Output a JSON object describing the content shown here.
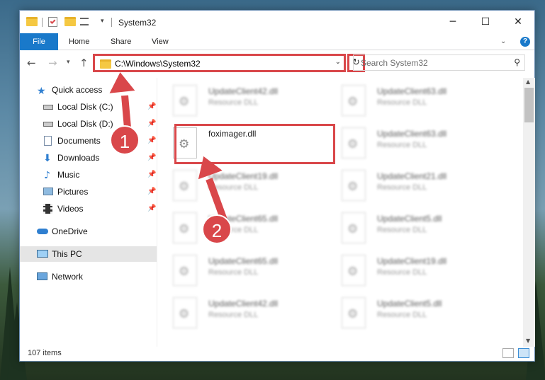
{
  "titlebar": {
    "title": "System32",
    "minimize_symbol": "─",
    "maximize_symbol": "☐",
    "close_symbol": "✕"
  },
  "ribbon": {
    "tabs": [
      "File",
      "Home",
      "Share",
      "View"
    ],
    "help_symbol": "?"
  },
  "navigation": {
    "address": "C:\\Windows\\System32",
    "search_placeholder": "Search System32"
  },
  "sidebar": {
    "items": [
      {
        "label": "Quick access",
        "icon": "star-icon",
        "pinned": false
      },
      {
        "label": "Local Disk (C:)",
        "icon": "drive-icon",
        "pinned": true
      },
      {
        "label": "Local Disk (D:)",
        "icon": "drive-icon",
        "pinned": true
      },
      {
        "label": "Documents",
        "icon": "documents-icon",
        "pinned": true
      },
      {
        "label": "Downloads",
        "icon": "download-icon",
        "pinned": true
      },
      {
        "label": "Music",
        "icon": "music-icon",
        "pinned": true
      },
      {
        "label": "Pictures",
        "icon": "pictures-icon",
        "pinned": true
      },
      {
        "label": "Videos",
        "icon": "videos-icon",
        "pinned": true
      },
      {
        "label": "OneDrive",
        "icon": "cloud-icon",
        "pinned": false
      },
      {
        "label": "This PC",
        "icon": "computer-icon",
        "pinned": false,
        "selected": true
      },
      {
        "label": "Network",
        "icon": "network-icon",
        "pinned": false
      }
    ]
  },
  "files": {
    "items": [
      {
        "name": "UpdateClient42.dll",
        "type": "Resource DLL",
        "blurred": true
      },
      {
        "name": "UpdateClient63.dll",
        "type": "Resource DLL",
        "blurred": true
      },
      {
        "name": "foximager.dll",
        "type": "",
        "blurred": false
      },
      {
        "name": "UpdateClient63.dll",
        "type": "Resource DLL",
        "blurred": true
      },
      {
        "name": "UpdateClient19.dll",
        "type": "Resource DLL",
        "blurred": true
      },
      {
        "name": "UpdateClient21.dll",
        "type": "Resource DLL",
        "blurred": true
      },
      {
        "name": "UpdateClient65.dll",
        "type": "Resource DLL",
        "blurred": true
      },
      {
        "name": "UpdateClient5.dll",
        "type": "Resource DLL",
        "blurred": true
      },
      {
        "name": "UpdateClient65.dll",
        "type": "Resource DLL",
        "blurred": true
      },
      {
        "name": "UpdateClient19.dll",
        "type": "Resource DLL",
        "blurred": true
      },
      {
        "name": "UpdateClient42.dll",
        "type": "Resource DLL",
        "blurred": true
      },
      {
        "name": "UpdateClient5.dll",
        "type": "Resource DLL",
        "blurred": true
      }
    ]
  },
  "status": {
    "item_count": "107 items"
  },
  "annotations": {
    "badge_1": "1",
    "badge_2": "2"
  },
  "colors": {
    "accent": "#1979ca",
    "highlight": "#d9474a"
  }
}
